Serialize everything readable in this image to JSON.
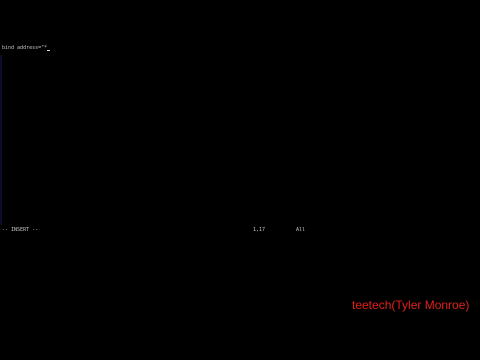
{
  "editor": {
    "buffer_lines": [
      {
        "text": "bind address=\"*"
      }
    ],
    "status": {
      "mode": "-- INSERT --",
      "position": "1,17",
      "scroll": "All"
    }
  },
  "overlay": {
    "watermark": "teetech(Tyler Monroe)"
  },
  "colors": {
    "background": "#000000",
    "text": "#c8c8c8",
    "watermark": "#e0201a"
  }
}
